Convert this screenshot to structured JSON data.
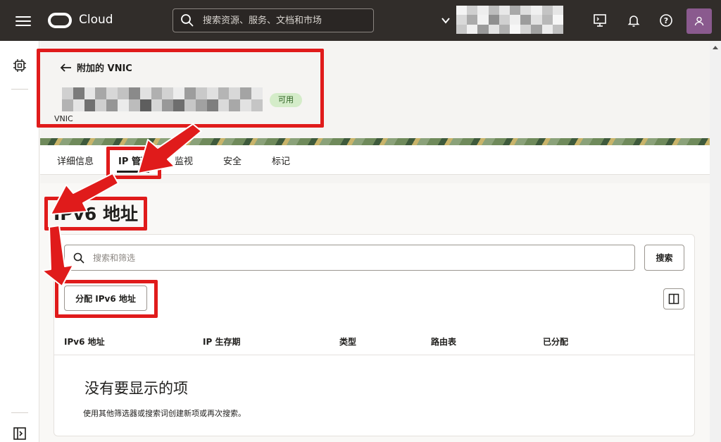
{
  "topbar": {
    "brand": "Cloud",
    "search_placeholder": "搜索资源、服务、文档和市场"
  },
  "header": {
    "back_label": "附加的 VNIC",
    "status": "可用",
    "resource_type": "VNIC"
  },
  "tabs": [
    {
      "label": "详细信息"
    },
    {
      "label": "IP 管理"
    },
    {
      "label": "监视"
    },
    {
      "label": "安全"
    },
    {
      "label": "标记"
    }
  ],
  "main": {
    "title": "IPv6 地址",
    "filter_placeholder": "搜索和筛选",
    "search_button": "搜索",
    "assign_button": "分配 IPv6 地址",
    "columns": [
      "IPv6 地址",
      "IP 生存期",
      "类型",
      "路由表",
      "已分配"
    ],
    "empty_title": "没有要显示的项",
    "empty_desc": "使用其他筛选器或搜索词创建新项或再次搜索。"
  },
  "colors": {
    "topbar_bg": "#312d2a",
    "annotation_red": "#e01b1b",
    "status_green_bg": "#d4ecc9"
  }
}
